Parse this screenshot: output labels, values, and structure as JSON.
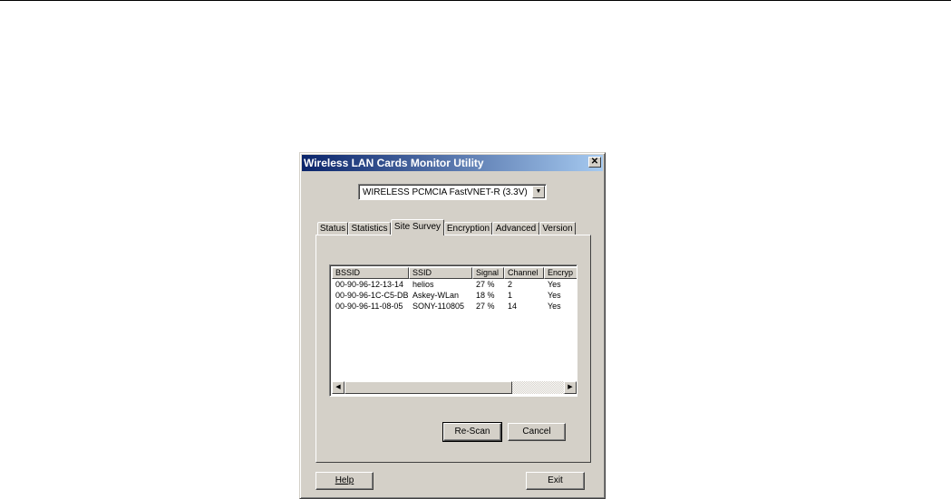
{
  "window": {
    "title": "Wireless LAN Cards Monitor Utility",
    "close_glyph": "✕"
  },
  "adapter": {
    "selected": "WIRELESS PCMCIA FastVNET-R (3.3V)",
    "dropdown_glyph": "▼"
  },
  "tabs": [
    {
      "label": "Status"
    },
    {
      "label": "Statistics"
    },
    {
      "label": "Site Survey",
      "active": true
    },
    {
      "label": "Encryption"
    },
    {
      "label": "Advanced"
    },
    {
      "label": "Version"
    }
  ],
  "survey": {
    "columns": [
      "BSSID",
      "SSID",
      "Signal",
      "Channel",
      "Encryp"
    ],
    "rows": [
      [
        "00-90-96-12-13-14",
        "helios",
        "27 %",
        "2",
        "Yes"
      ],
      [
        "00-90-96-1C-C5-DB",
        "Askey-WLan",
        "18 %",
        "1",
        "Yes"
      ],
      [
        "00-90-96-11-08-05",
        "SONY-110805",
        "27 %",
        "14",
        "Yes"
      ]
    ],
    "scroll_left_glyph": "◀",
    "scroll_right_glyph": "▶",
    "rescan_label": "Re-Scan",
    "cancel_label": "Cancel"
  },
  "footer": {
    "help_label": "Help",
    "exit_label": "Exit"
  }
}
